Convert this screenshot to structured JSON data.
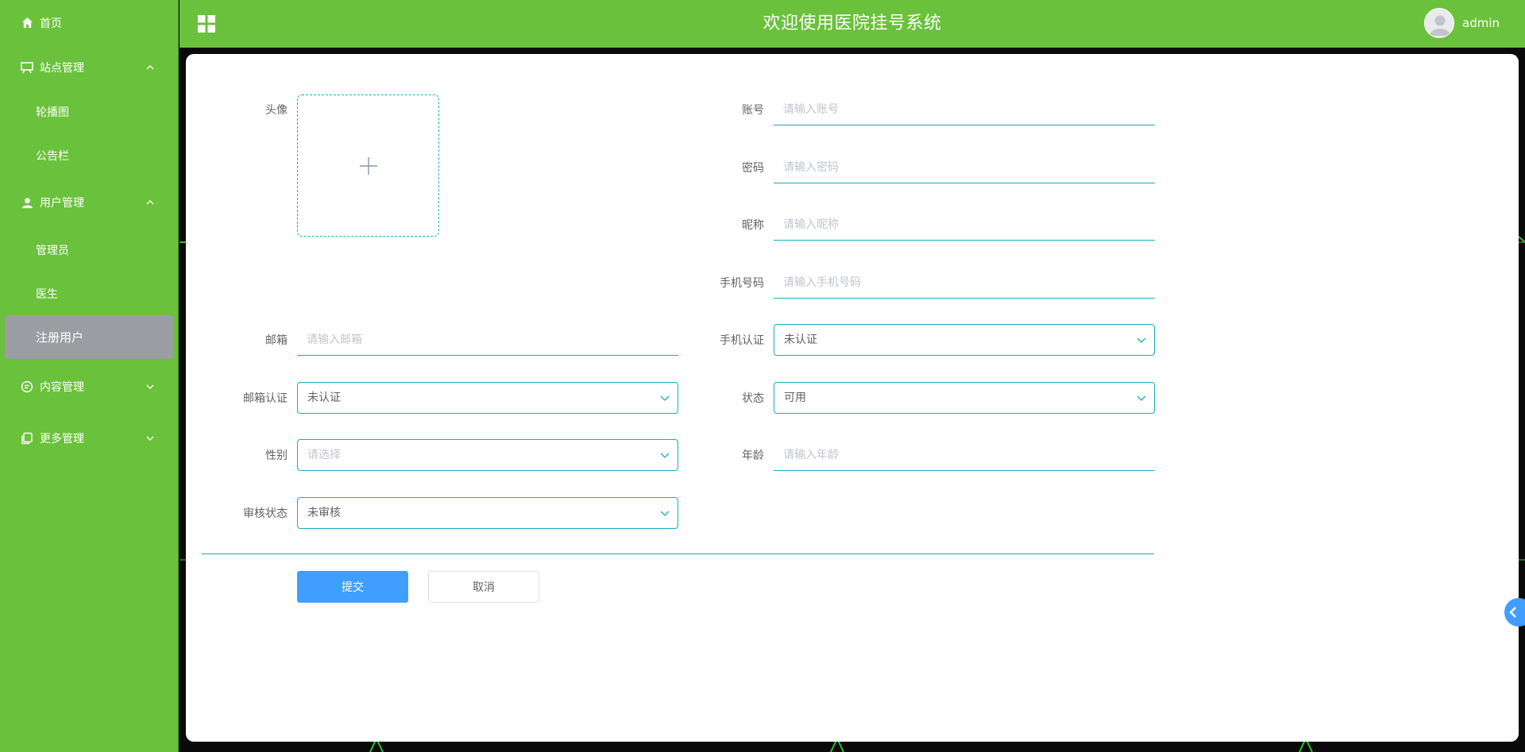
{
  "header": {
    "title": "欢迎使用医院挂号系统",
    "username": "admin"
  },
  "sidebar": {
    "home": "首页",
    "site": {
      "label": "站点管理",
      "items": [
        "轮播图",
        "公告栏"
      ]
    },
    "users": {
      "label": "用户管理",
      "items": [
        "管理员",
        "医生",
        "注册用户"
      ]
    },
    "content": {
      "label": "内容管理"
    },
    "more": {
      "label": "更多管理"
    }
  },
  "form": {
    "avatar_label": "头像",
    "account": {
      "label": "账号",
      "placeholder": "请输入账号"
    },
    "password": {
      "label": "密码",
      "placeholder": "请输入密码"
    },
    "nickname": {
      "label": "昵称",
      "placeholder": "请输入昵称"
    },
    "phone": {
      "label": "手机号码",
      "placeholder": "请输入手机号码"
    },
    "email": {
      "label": "邮箱",
      "placeholder": "请输入邮箱"
    },
    "phone_verify": {
      "label": "手机认证",
      "value": "未认证"
    },
    "email_verify": {
      "label": "邮箱认证",
      "value": "未认证"
    },
    "status": {
      "label": "状态",
      "value": "可用"
    },
    "gender": {
      "label": "性别",
      "placeholder": "请选择"
    },
    "age": {
      "label": "年龄",
      "placeholder": "请输入年龄"
    },
    "audit": {
      "label": "审核状态",
      "value": "未审核"
    },
    "submit": "提交",
    "cancel": "取消"
  },
  "colors": {
    "theme": "#6ac13b",
    "accent": "#1aaebb",
    "primary": "#409eff",
    "active_item": "#9a9ea3"
  },
  "icons": [
    "home-icon",
    "presentation-icon",
    "user-icon",
    "chat-icon",
    "copy-icon",
    "grid-icon",
    "plus-icon",
    "chevron-down-icon",
    "chevron-up-icon",
    "chevron-left-icon"
  ]
}
